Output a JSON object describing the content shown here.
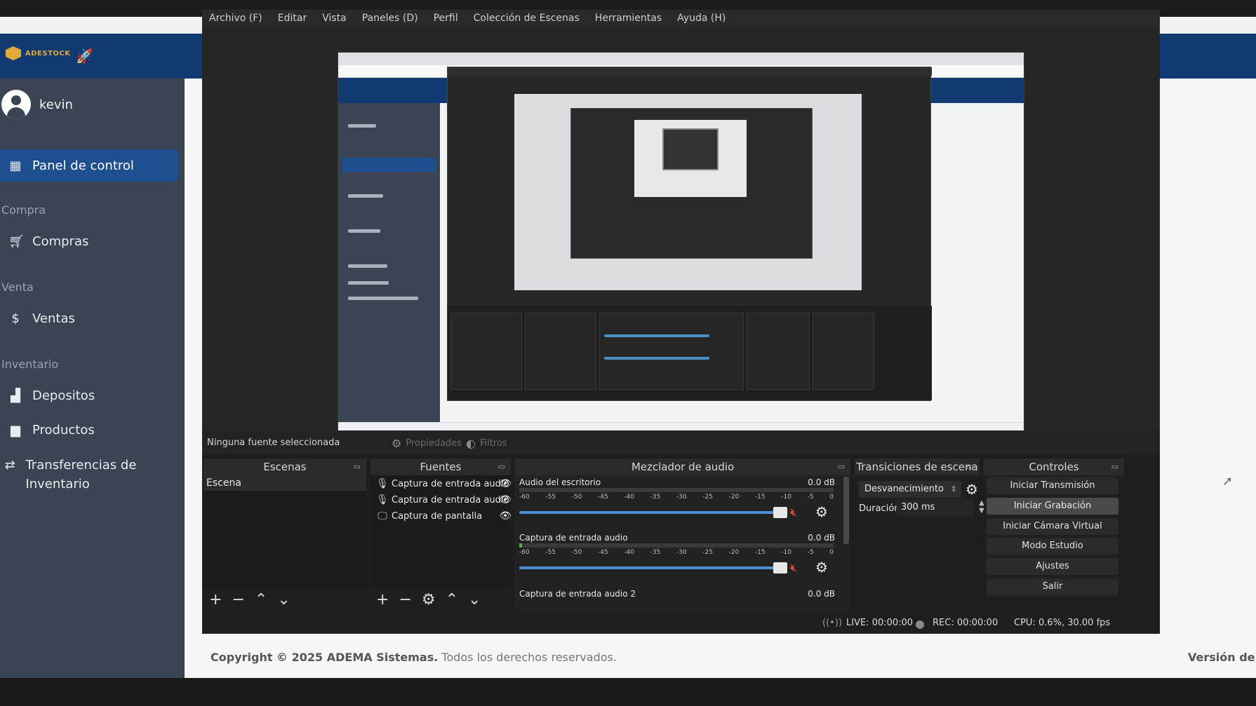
{
  "obs": {
    "menu": [
      "Archivo (F)",
      "Editar",
      "Vista",
      "Paneles (D)",
      "Perfil",
      "Colección de Escenas",
      "Herramientas",
      "Ayuda (H)"
    ],
    "status_no_source": "Ninguna fuente seleccionada",
    "properties_label": "Propiedades",
    "filters_label": "Filtros",
    "docks": {
      "scenes_title": "Escenas",
      "sources_title": "Fuentes",
      "mixer_title": "Mezclador de audio",
      "transitions_title": "Transiciones de escena",
      "controls_title": "Controles"
    },
    "scenes": [
      "Escena"
    ],
    "sources": [
      {
        "label": "Captura de entrada audio",
        "icon": "mic-icon"
      },
      {
        "label": "Captura de entrada audio",
        "icon": "mic-icon"
      },
      {
        "label": "Captura de pantalla",
        "icon": "monitor-icon"
      }
    ],
    "mixer": [
      {
        "label": "Audio del escritorio",
        "db": "0.0 dB",
        "level": 0.0
      },
      {
        "label": "Captura de entrada audio",
        "db": "0.0 dB",
        "level": 0.01
      },
      {
        "label": "Captura de entrada audio 2",
        "db": "0.0 dB"
      }
    ],
    "meter_ticks": [
      "-60",
      "-55",
      "-50",
      "-45",
      "-40",
      "-35",
      "-30",
      "-25",
      "-20",
      "-15",
      "-10",
      "-5",
      "0"
    ],
    "transition": {
      "selected": "Desvanecimiento",
      "duration_label": "Duración",
      "duration_value": "300 ms"
    },
    "controls": [
      "Iniciar Transmisión",
      "Iniciar Grabación",
      "Iniciar Cámara Virtual",
      "Modo Estudio",
      "Ajustes",
      "Salir"
    ],
    "statusbar": {
      "live": "LIVE: 00:00:00",
      "rec": "REC: 00:00:00",
      "cpu": "CPU: 0.6%, 30.00 fps"
    }
  },
  "app": {
    "logo": "ADESTOCK",
    "user": "kevin",
    "nav_active": "Panel de control",
    "sections": [
      {
        "title": "Compra",
        "items": [
          "Compras"
        ]
      },
      {
        "title": "Venta",
        "items": [
          "Ventas"
        ]
      },
      {
        "title": "Inventario",
        "items": [
          "Depositos",
          "Productos",
          "Transferencias de Inventario"
        ]
      }
    ],
    "footer_copyright": "Copyright © 2025 ADEMA Sistemas.",
    "footer_rights": "Todos los derechos reservados.",
    "footer_version": "Versión de J"
  }
}
